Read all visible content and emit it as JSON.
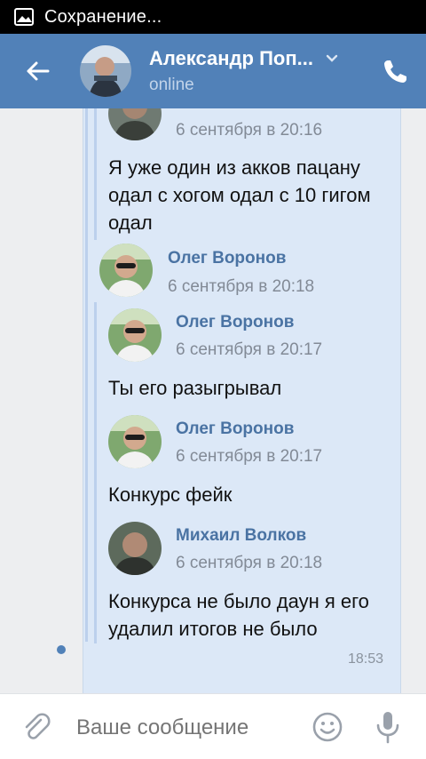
{
  "status_bar": {
    "text": "Сохранение..."
  },
  "header": {
    "name": "Александр Поп...",
    "status": "online"
  },
  "messages": [
    {
      "sender": "",
      "date": "6 сентября в 20:16",
      "text": "Я уже один из акков пацану одал с хогом одал с 10 гигом одал"
    },
    {
      "sender": "Олег Воронов",
      "date": "6 сентября в 20:18",
      "text": ""
    },
    {
      "sender": "Олег Воронов",
      "date": "6 сентября в 20:17",
      "text": "Ты его разыгрывал"
    },
    {
      "sender": "Олег Воронов",
      "date": "6 сентября в 20:17",
      "text": "Конкурс фейк"
    },
    {
      "sender": "Михаил Волков",
      "date": "6 сентября в 20:18",
      "text": "Конкурса не было даун я его удалил итогов не было"
    }
  ],
  "bubble_time": "18:53",
  "composer": {
    "placeholder": "Ваше сообщение"
  },
  "colors": {
    "header_bg": "#5181b8",
    "bubble_bg": "#dce8f7",
    "name_color": "#4a73a3"
  }
}
